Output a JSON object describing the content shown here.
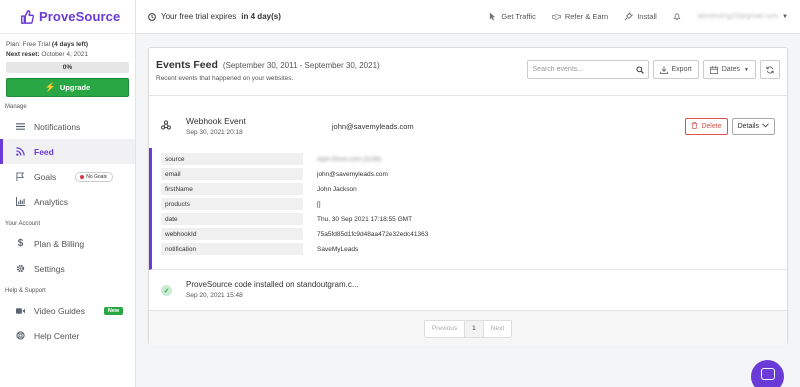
{
  "brand": {
    "name": "ProveSource"
  },
  "plan": {
    "plan_label": "Plan:",
    "plan_value": "Free Trial",
    "plan_note": "(4 days left)",
    "reset_label": "Next reset:",
    "reset_value": "October 4, 2021",
    "progress_text": "0%",
    "progress_fraction": 0,
    "upgrade_label": "Upgrade"
  },
  "sidebar": {
    "manage_label": "Manage",
    "account_label": "Your Account",
    "support_label": "Help & Support",
    "items": [
      {
        "label": "Notifications",
        "icon": "list-icon"
      },
      {
        "label": "Feed",
        "icon": "rss-icon"
      },
      {
        "label": "Goals",
        "icon": "flag-icon",
        "badge": "No Goals"
      },
      {
        "label": "Analytics",
        "icon": "bar-chart-icon"
      },
      {
        "label": "Plan & Billing",
        "icon": "dollar-icon"
      },
      {
        "label": "Settings",
        "icon": "gear-icon"
      },
      {
        "label": "Video Guides",
        "icon": "video-icon",
        "badge": "New"
      },
      {
        "label": "Help Center",
        "icon": "lifebuoy-icon"
      }
    ]
  },
  "topbar": {
    "trial_prefix": "Your free trial expires",
    "trial_bold": "in 4 day(s)",
    "get_traffic": "Get Traffic",
    "refer_earn": "Refer & Earn",
    "install": "Install",
    "user_email": "alextesting23@gmail.com"
  },
  "feed": {
    "title": "Events Feed",
    "range": "(September 30, 2011 - September 30, 2021)",
    "subtitle": "Recent events that happened on your websites.",
    "search_placeholder": "Search events...",
    "export_label": "Export",
    "dates_label": "Dates"
  },
  "event1": {
    "title": "Webhook Event",
    "time": "Sep 30, 2021 20:18",
    "email": "john@savemyleads.com",
    "delete_label": "Delete",
    "details_label": "Details",
    "rows": [
      {
        "key": "source",
        "value": "Apix-Drive.com (1136)"
      },
      {
        "key": "email",
        "value": "john@savemyleads.com"
      },
      {
        "key": "firstName",
        "value": "John Jackson"
      },
      {
        "key": "products",
        "value": "[]"
      },
      {
        "key": "date",
        "value": "Thu, 30 Sep 2021 17:18:55 GMT"
      },
      {
        "key": "webhookId",
        "value": "75a5fd85d1fc9d48aa472e32edc41363"
      },
      {
        "key": "notification",
        "value": "SaveMyLeads"
      }
    ]
  },
  "event2": {
    "title": "ProveSource code installed on standoutgram.c...",
    "time": "Sep 20, 2021 15:48"
  },
  "pagination": {
    "previous": "Previous",
    "current": "1",
    "next": "Next"
  },
  "colors": {
    "brand": "#6a3bd6",
    "success": "#2aa745",
    "danger": "#d9534f"
  }
}
